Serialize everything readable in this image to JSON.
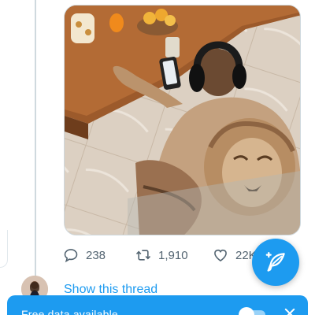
{
  "tweet": {
    "image_alt": "Man with a large lion back tattoo wearing headphones, holding a phone and a drink at a wooden table",
    "stats": {
      "replies": "238",
      "retweets": "1,910",
      "likes": "22K"
    }
  },
  "thread": {
    "show_thread_label": "Show this thread"
  },
  "toast": {
    "message": "Free data available"
  },
  "colors": {
    "accent": "#1d9bf0",
    "text_secondary": "#536471",
    "divider": "#cfd9de"
  },
  "icons": {
    "reply": "reply-icon",
    "retweet": "retweet-icon",
    "like": "heart-icon",
    "compose": "compose-feather-icon",
    "close": "close-icon"
  }
}
